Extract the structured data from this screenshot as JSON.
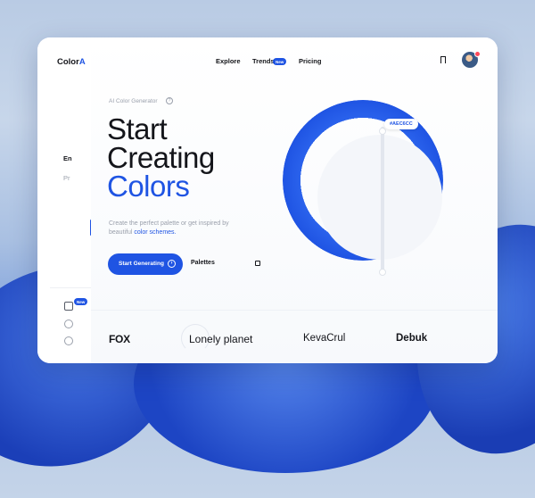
{
  "app": {
    "logo_text": "Color",
    "logo_accent": "A"
  },
  "sidebar": {
    "languages": [
      {
        "label": "En",
        "active": true
      },
      {
        "label": "Pr",
        "active": false
      }
    ],
    "social_badge": "New",
    "social_icons": [
      "instagram-icon",
      "dribbble-icon",
      "pinterest-icon"
    ]
  },
  "nav": {
    "items": [
      {
        "label": "Explore"
      },
      {
        "label": "Trends",
        "badge": "New"
      },
      {
        "label": "Pricing"
      }
    ],
    "bookmark_icon": "bookmark-icon"
  },
  "hero": {
    "eyebrow": "AI Color Generator",
    "title_line1": "Start",
    "title_line2": "Creating",
    "title_line3": "Colors",
    "desc_prefix": "Create the perfect palette or get inspired by beautiful ",
    "desc_highlight": "color schemes.",
    "primary_button": "Start Generating",
    "secondary_button": "Palettes"
  },
  "color_picker": {
    "hex": "#AEC6CC",
    "ring_color": "#1f54e3"
  },
  "brands": {
    "items": [
      "FOX",
      "Lonely planet",
      "KevaCrul",
      "Debuk"
    ]
  },
  "colors": {
    "accent": "#1f54e3",
    "text": "#14151a",
    "muted": "#9aa0ab"
  }
}
